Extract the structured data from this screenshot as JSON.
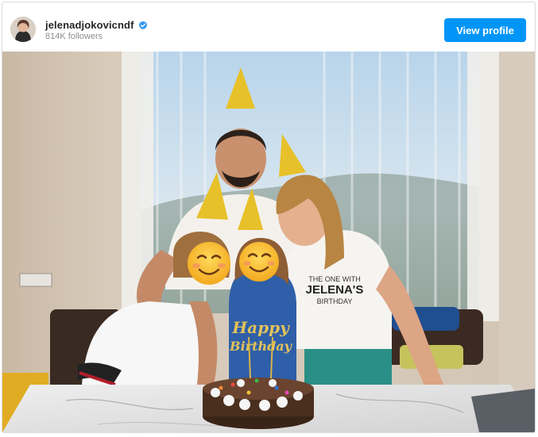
{
  "post": {
    "username": "jelenadjokovicndf",
    "followers": "814K followers",
    "verified": true,
    "view_profile_label": "View profile"
  },
  "icons": {
    "verified": "verified-badge-icon",
    "avatar": "profile-avatar"
  },
  "photo": {
    "cake_topper_text": "Happy Birthday",
    "shirt_text": "THE ONE WITH JELENA'S BIRTHDAY"
  },
  "colors": {
    "accent": "#0095f6",
    "username": "#262626",
    "secondary_text": "#8e8e8e",
    "border": "#dbdbdb"
  }
}
